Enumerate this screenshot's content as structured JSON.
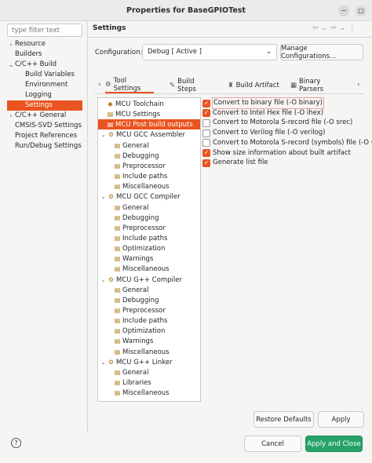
{
  "window": {
    "title": "Properties for BaseGPIOTest",
    "minimize_glyph": "−",
    "maximize_glyph": "▢",
    "close_glyph": "✕"
  },
  "filter": {
    "placeholder": "type filter text"
  },
  "nav": [
    {
      "label": "Resource",
      "arrow": "›"
    },
    {
      "label": "Builders",
      "arrow": ""
    },
    {
      "label": "C/C++ Build",
      "arrow": "⌄"
    },
    {
      "label": "Build Variables",
      "arrow": ""
    },
    {
      "label": "Environment",
      "arrow": ""
    },
    {
      "label": "Logging",
      "arrow": ""
    },
    {
      "label": "Settings",
      "arrow": ""
    },
    {
      "label": "C/C++ General",
      "arrow": "›"
    },
    {
      "label": "CMSIS-SVD Settings",
      "arrow": ""
    },
    {
      "label": "Project References",
      "arrow": ""
    },
    {
      "label": "Run/Debug Settings",
      "arrow": ""
    }
  ],
  "main": {
    "title": "Settings",
    "toolbar_icons": [
      "⇦",
      "⌄",
      "⇨",
      "⌄",
      "⋮"
    ],
    "configuration_label": "Configuration:",
    "configuration_value": "Debug  [ Active ]",
    "configuration_arrow": "⌄",
    "manage_label": "Manage Configurations..."
  },
  "tabs": [
    {
      "label": "Tool Settings",
      "icon": "⚙",
      "icon_name": "tool-settings-icon"
    },
    {
      "label": "Build Steps",
      "icon": "✎",
      "icon_name": "build-steps-icon"
    },
    {
      "label": "Build Artifact",
      "icon": "♜",
      "icon_name": "build-artifact-icon"
    },
    {
      "label": "Binary Parsers",
      "icon": "▦",
      "icon_name": "binary-parsers-icon"
    }
  ],
  "tabs_more": "›",
  "tree": [
    {
      "label": "MCU Toolchain",
      "level": 0,
      "twisty": "",
      "icon": "◆"
    },
    {
      "label": "MCU Settings",
      "level": 0,
      "twisty": "",
      "icon": "▤"
    },
    {
      "label": "MCU Post build outputs",
      "level": 0,
      "twisty": "",
      "icon": "▤"
    },
    {
      "label": "MCU GCC Assembler",
      "level": 0,
      "twisty": "⌄",
      "icon": "⚙"
    },
    {
      "label": "General",
      "level": 1,
      "twisty": "",
      "icon": "▤"
    },
    {
      "label": "Debugging",
      "level": 1,
      "twisty": "",
      "icon": "▤"
    },
    {
      "label": "Preprocessor",
      "level": 1,
      "twisty": "",
      "icon": "▤"
    },
    {
      "label": "Include paths",
      "level": 1,
      "twisty": "",
      "icon": "▤"
    },
    {
      "label": "Miscellaneous",
      "level": 1,
      "twisty": "",
      "icon": "▤"
    },
    {
      "label": "MCU GCC Compiler",
      "level": 0,
      "twisty": "⌄",
      "icon": "⚙"
    },
    {
      "label": "General",
      "level": 1,
      "twisty": "",
      "icon": "▤"
    },
    {
      "label": "Debugging",
      "level": 1,
      "twisty": "",
      "icon": "▤"
    },
    {
      "label": "Preprocessor",
      "level": 1,
      "twisty": "",
      "icon": "▤"
    },
    {
      "label": "Include paths",
      "level": 1,
      "twisty": "",
      "icon": "▤"
    },
    {
      "label": "Optimization",
      "level": 1,
      "twisty": "",
      "icon": "▤"
    },
    {
      "label": "Warnings",
      "level": 1,
      "twisty": "",
      "icon": "▤"
    },
    {
      "label": "Miscellaneous",
      "level": 1,
      "twisty": "",
      "icon": "▤"
    },
    {
      "label": "MCU G++ Compiler",
      "level": 0,
      "twisty": "⌄",
      "icon": "⚙"
    },
    {
      "label": "General",
      "level": 1,
      "twisty": "",
      "icon": "▤"
    },
    {
      "label": "Debugging",
      "level": 1,
      "twisty": "",
      "icon": "▤"
    },
    {
      "label": "Preprocessor",
      "level": 1,
      "twisty": "",
      "icon": "▤"
    },
    {
      "label": "Include paths",
      "level": 1,
      "twisty": "",
      "icon": "▤"
    },
    {
      "label": "Optimization",
      "level": 1,
      "twisty": "",
      "icon": "▤"
    },
    {
      "label": "Warnings",
      "level": 1,
      "twisty": "",
      "icon": "▤"
    },
    {
      "label": "Miscellaneous",
      "level": 1,
      "twisty": "",
      "icon": "▤"
    },
    {
      "label": "MCU G++ Linker",
      "level": 0,
      "twisty": "⌄",
      "icon": "⚙"
    },
    {
      "label": "General",
      "level": 1,
      "twisty": "",
      "icon": "▤"
    },
    {
      "label": "Libraries",
      "level": 1,
      "twisty": "",
      "icon": "▤"
    },
    {
      "label": "Miscellaneous",
      "level": 1,
      "twisty": "",
      "icon": "▤"
    }
  ],
  "options": [
    {
      "label": "Convert to binary file (-O binary)",
      "checked": true
    },
    {
      "label": "Convert to Intel Hex file (-O ihex)",
      "checked": true
    },
    {
      "label": "Convert to Motorola S-record file (-O srec)",
      "checked": false
    },
    {
      "label": "Convert to Verilog file (-O verilog)",
      "checked": false
    },
    {
      "label": "Convert to Motorola S-record (symbols) file (-O s",
      "checked": false
    },
    {
      "label": "Show size information about built artifact",
      "checked": true
    },
    {
      "label": "Generate list file",
      "checked": true
    }
  ],
  "buttons": {
    "restore_defaults": "Restore Defaults",
    "apply": "Apply",
    "cancel": "Cancel",
    "apply_and_close": "Apply and Close",
    "help": "?"
  },
  "colors": {
    "accent": "#e95420",
    "primary_button": "#26a269"
  }
}
